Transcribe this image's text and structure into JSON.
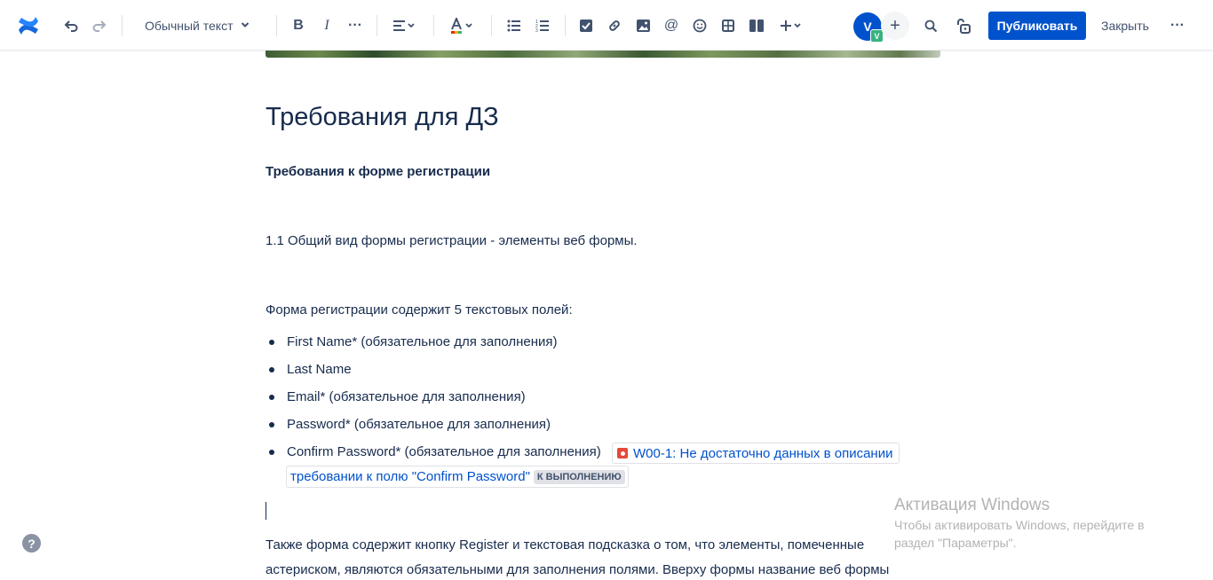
{
  "toolbar": {
    "text_style": "Обычный текст",
    "publish_label": "Публиковать",
    "close_label": "Закрыть",
    "avatar_initial": "V",
    "avatar_badge": "V",
    "brand_color": "#0052cc"
  },
  "icons": [
    "confluence-logo",
    "undo",
    "redo",
    "bold",
    "italic",
    "more-formatting",
    "align",
    "text-color",
    "bullet-list",
    "numbered-list",
    "action-item",
    "link",
    "image",
    "mention",
    "emoji",
    "table",
    "layouts",
    "insert",
    "search",
    "restrictions",
    "more"
  ],
  "page": {
    "title": "Требования для ДЗ",
    "section_heading": "Требования к форме регистрации",
    "para1": "1.1 Общий вид формы регистрации - элементы веб формы.",
    "para2": "Форма регистрации содержит 5 текстовых полей:",
    "list": [
      "First Name* (обязательное для заполнения)",
      "Last Name",
      "Email* (обязательное для заполнения)",
      "Password* (обязательное для заполнения)",
      "Confirm Password* (обязательное для заполнения)"
    ],
    "jira_issue": {
      "key_title_line1": "W00-1: Не достаточно данных в описании",
      "title_line2": "требовании к полю \"Confirm Password\"",
      "status": "К ВЫПОЛНЕНИЮ"
    },
    "para3_line1": "Также форма содержит кнопку Register и текстовая подсказка о том, что элементы, помеченные",
    "para3_line2": "астериском, являются обязательными для заполнения полями. Вверху формы название веб формы"
  },
  "help_label": "?",
  "watermark": {
    "title": "Активация Windows",
    "text": "Чтобы активировать Windows, перейдите в раздел \"Параметры\"."
  }
}
